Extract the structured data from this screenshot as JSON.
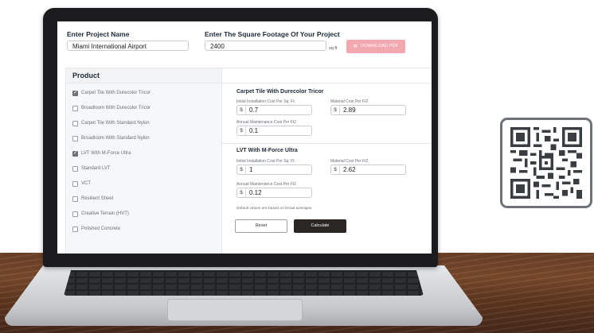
{
  "form": {
    "project_name_label": "Enter Project Name",
    "project_name_value": "Miami International Airport",
    "sqft_label": "Enter The Square Footage Of Your Project",
    "sqft_value": "2400",
    "sqft_unit": "sq ft",
    "download_label": "DOWNLOAD PDF"
  },
  "product_header": "Product",
  "products": [
    {
      "label": "Carpet Tile With Durecolor Tricor",
      "checked": true
    },
    {
      "label": "Broadloom With Durecolor Tricor",
      "checked": false
    },
    {
      "label": "Carpet Tile With Standard Nylon",
      "checked": false
    },
    {
      "label": "Broadloom With Standard Nylon",
      "checked": false
    },
    {
      "label": "LVT With M-Force Ultra",
      "checked": true
    },
    {
      "label": "Standard LVT",
      "checked": false
    },
    {
      "label": "VCT",
      "checked": false
    },
    {
      "label": "Resilient Sheet",
      "checked": false
    },
    {
      "label": "Creative Terrain (HVT)",
      "checked": false
    },
    {
      "label": "Polished Concrete",
      "checked": false
    }
  ],
  "sections": [
    {
      "title": "Carpet Tile With Durecolor Tricor",
      "install_label": "Initial Installation Cost Per Sq. Ft.",
      "install_value": "0.7",
      "material_label": "Material Cost Per Ft2",
      "material_value": "2.89",
      "maint_label": "Annual Maintenance Cost Per Ft2",
      "maint_value": "0.1"
    },
    {
      "title": "LVT With M-Force Ultra",
      "install_label": "Initial Installation Cost Per Sq. Ft.",
      "install_value": "1",
      "material_label": "Material Cost Per Ft2",
      "material_value": "2.62",
      "maint_label": "Annual Maintenance Cost Per Ft2",
      "maint_value": "0.12"
    }
  ],
  "currency": "$",
  "note": "Default values are based on broad averages.",
  "reset_label": "Reset",
  "calculate_label": "Calculate",
  "colors": {
    "download_button": "#f3a7ae",
    "calculate_button": "#2a2624",
    "heading_text": "#1e2a37"
  },
  "icons": [
    "pdf-icon",
    "qr-code-icon"
  ]
}
